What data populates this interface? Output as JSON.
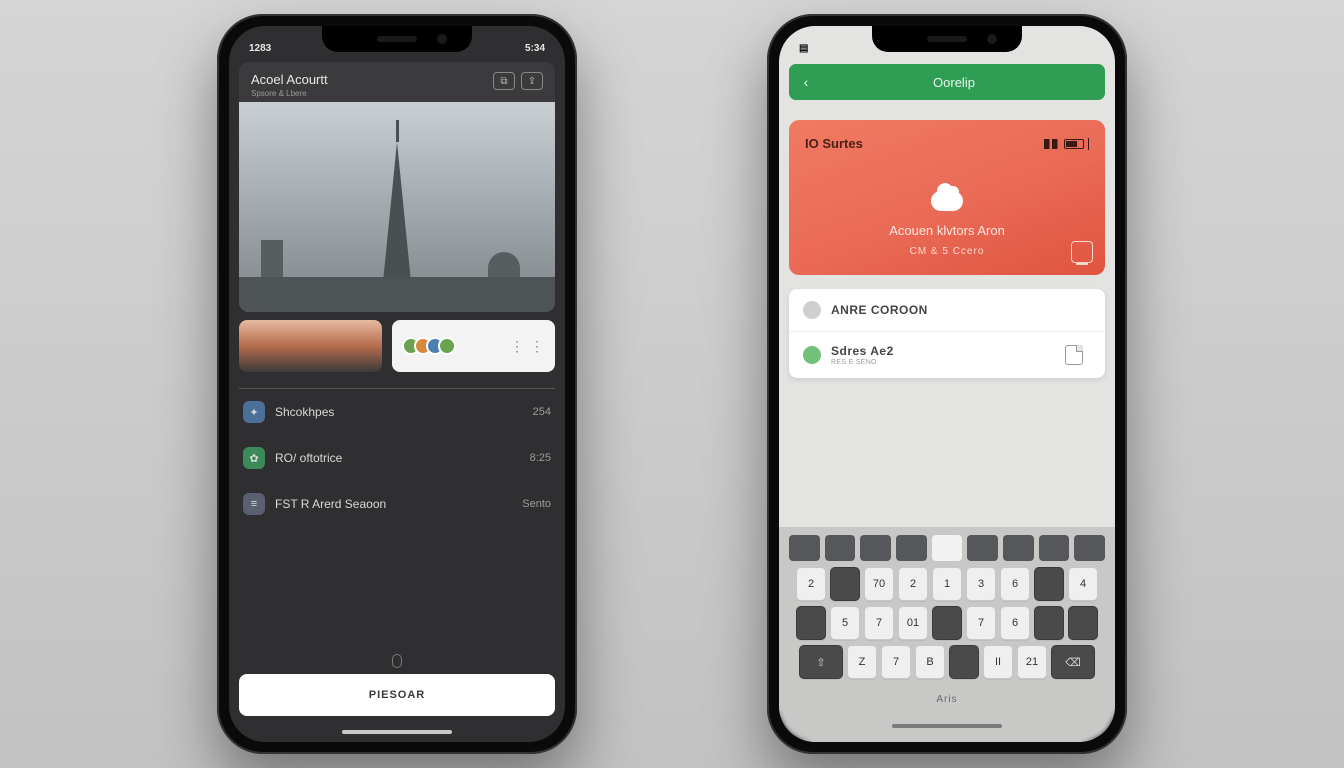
{
  "left": {
    "status": {
      "time": "1283",
      "right": "5:34"
    },
    "hero": {
      "title": "Acoel Acourtt",
      "subtitle": "Spsore & Lbere"
    },
    "list": [
      {
        "label": "Shcokhpes",
        "value": "254"
      },
      {
        "label": "RO/ oftotrice",
        "value": "8:25"
      },
      {
        "label": "FST R Arerd Seaoon",
        "value": "Sento"
      }
    ],
    "button": "PIESOAR"
  },
  "right": {
    "greenbar": "Oorelip",
    "card": {
      "top": "IO Surtes",
      "line1": "Acouen klvtors Aron",
      "line2": "CM & 5 Ccero"
    },
    "suggestions": [
      {
        "title": "ANRE COROON"
      },
      {
        "title": "Sdres Ae2",
        "sub": "RES E SENO"
      }
    ],
    "keyboard": {
      "suggestion": "Aris",
      "row2": [
        "2",
        "",
        "70",
        "2",
        "1",
        "3",
        "6",
        "",
        "4"
      ],
      "row3": [
        "",
        "5",
        "7",
        "01",
        "",
        "7",
        "6",
        "",
        ""
      ],
      "row4": [
        "",
        "Z",
        "7",
        "B",
        "",
        "II",
        "21",
        "",
        ""
      ]
    }
  }
}
